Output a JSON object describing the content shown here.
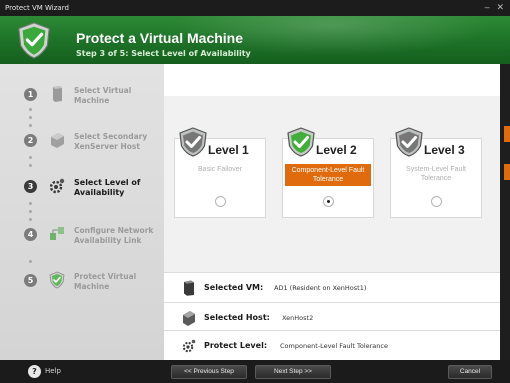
{
  "window": {
    "title": "Protect VM Wizard",
    "minimize_glyph": "‒",
    "close_glyph": "✕"
  },
  "header": {
    "title": "Protect a Virtual Machine",
    "subtitle": "Step 3 of 5:  Select Level of Availability",
    "icon": "green-shield-check-icon"
  },
  "sidebar": {
    "steps": [
      {
        "number": "1",
        "label": "Select Virtual Machine",
        "icon": "virtual-machine-icon",
        "active": false
      },
      {
        "number": "2",
        "label": "Select Secondary XenServer Host",
        "icon": "server-host-icon",
        "active": false
      },
      {
        "number": "3",
        "label": "Select Level of Availability",
        "icon": "availability-gear-icon",
        "active": true
      },
      {
        "number": "4",
        "label": "Configure Network Availability Link",
        "icon": "network-link-icon",
        "active": false
      },
      {
        "number": "5",
        "label": "Protect Virtual Machine",
        "icon": "shield-check-icon",
        "active": false
      }
    ]
  },
  "levels": [
    {
      "title": "Level 1",
      "description": "Basic Failover",
      "selected": false,
      "icon": "shield-check-icon"
    },
    {
      "title": "Level 2",
      "description": "Component-Level Fault Tolerance",
      "selected": true,
      "icon": "shield-check-icon"
    },
    {
      "title": "Level 3",
      "description": "System-Level Fault Tolerance",
      "selected": false,
      "icon": "shield-check-icon"
    }
  ],
  "summary": {
    "vm_label": "Selected VM:",
    "vm_value": "AD1 (Resident on XenHost1)",
    "host_label": "Selected Host:",
    "host_value": "XenHost2",
    "level_label": "Protect Level:",
    "level_value": "Component-Level Fault Tolerance"
  },
  "footer": {
    "help_label": "Help",
    "prev_label": "<< Previous Step",
    "next_label": "Next Step >>",
    "cancel_label": "Cancel"
  },
  "colors": {
    "header_green": "#1f7629",
    "accent_orange": "#e06b0c",
    "check_green": "#3fae3a"
  }
}
